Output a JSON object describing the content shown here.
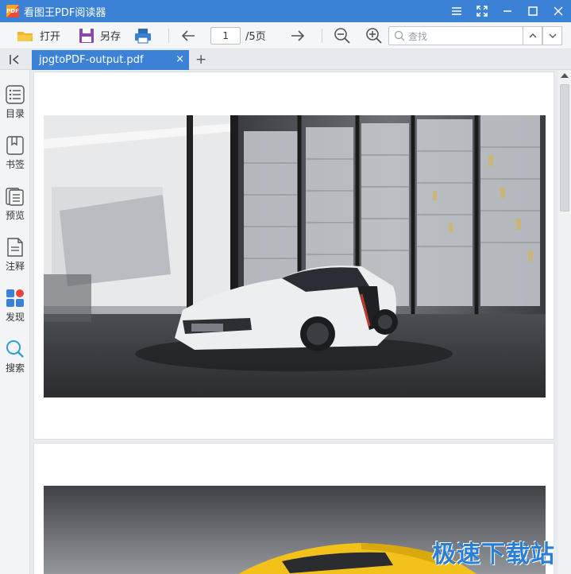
{
  "window": {
    "logo_text": "PDF",
    "title": "看图王PDF阅读器"
  },
  "toolbar": {
    "open_label": "打开",
    "save_as_label": "另存",
    "page_current": "1",
    "page_total": "/5页",
    "search_placeholder": "查找"
  },
  "tabs": {
    "active_label": "jpgtoPDF-output.pdf",
    "close_glyph": "×",
    "add_glyph": "+"
  },
  "sidebar": {
    "items": [
      {
        "label": "目录",
        "icon": "toc-icon"
      },
      {
        "label": "书签",
        "icon": "bookmark-icon"
      },
      {
        "label": "预览",
        "icon": "preview-icon"
      },
      {
        "label": "注释",
        "icon": "annotation-icon"
      },
      {
        "label": "发现",
        "icon": "discover-icon"
      },
      {
        "label": "搜索",
        "icon": "search-icon"
      }
    ]
  },
  "colors": {
    "accent": "#3b82d6",
    "discover_dot": "#e8453c"
  },
  "watermark": {
    "text": "极速下载站"
  }
}
